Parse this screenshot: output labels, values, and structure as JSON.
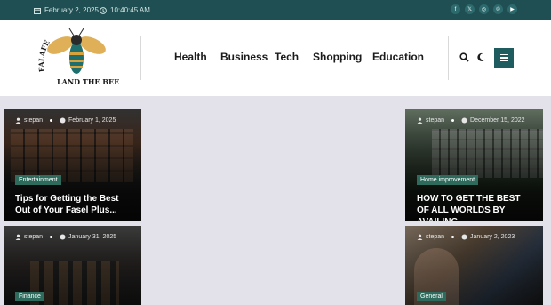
{
  "topbar": {
    "date": "February 2, 2025",
    "time": "10:40:45 AM",
    "social": [
      "facebook-icon",
      "x-icon",
      "instagram-icon",
      "pinterest-icon",
      "youtube-icon"
    ]
  },
  "site": {
    "logo_text": "FALAFE LAND THE BEE"
  },
  "nav": {
    "items": [
      "Health",
      "Business",
      "Tech",
      "Shopping",
      "Education"
    ]
  },
  "cards": [
    {
      "author": "stepan",
      "date": "February 1, 2025",
      "category": "Entertainment",
      "title": "Tips for Getting the Best Out of Your Fasel Plus..."
    },
    {
      "author": "stepan",
      "date": "January 31, 2025",
      "category": "Finance",
      "title": ""
    },
    {
      "author": "stepan",
      "date": "December 15, 2022",
      "category": "Home improvement",
      "title": "HOW TO GET THE BEST OF ALL WORLDS BY AVAILING..."
    },
    {
      "author": "stepan",
      "date": "January 2, 2023",
      "category": "General",
      "title": ""
    }
  ]
}
